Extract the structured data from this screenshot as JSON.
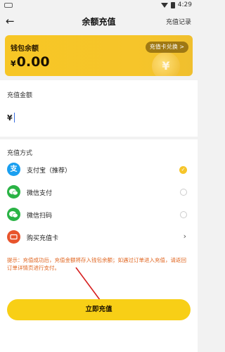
{
  "statusbar": {
    "time": "4:29"
  },
  "navbar": {
    "title": "余额充值",
    "record_label": "充值记录"
  },
  "wallet": {
    "label": "钱包余额",
    "currency": "¥",
    "amount": "0.00",
    "switch_label": "充值卡兑换 >",
    "coin_symbol": "¥"
  },
  "amount_section": {
    "label": "充值金额",
    "currency": "¥"
  },
  "payment": {
    "label": "充值方式",
    "methods": [
      {
        "name": "支付宝（推荐）",
        "icon": "alipay-icon",
        "color": "#1a9ff0",
        "glyph": "支",
        "selected": true
      },
      {
        "name": "微信支付",
        "icon": "wechat-pay-icon",
        "color": "#2ab345",
        "glyph": "●",
        "selected": false
      },
      {
        "name": "微信扫码",
        "icon": "wechat-scan-icon",
        "color": "#2ab345",
        "glyph": "●",
        "selected": false
      },
      {
        "name": "购买充值卡",
        "icon": "card-icon",
        "color": "#e8542c",
        "glyph": "▭",
        "selected": false
      }
    ]
  },
  "notice": "提示：充值成功后，充值金额将存入钱包余额；如遇过订单进入充值，请返回订单详情页进行支付。",
  "submit_label": "立即充值",
  "colors": {
    "accent": "#f8cf16",
    "notice": "#e0641e"
  }
}
